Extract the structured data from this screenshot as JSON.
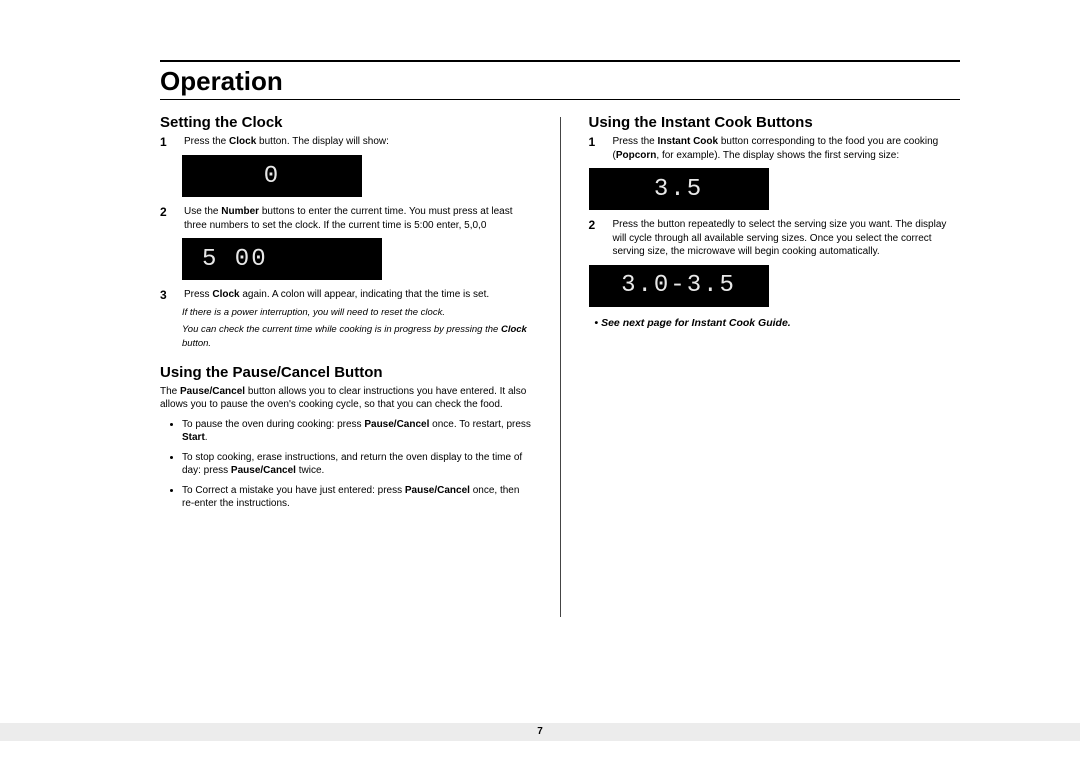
{
  "page_title": "Operation",
  "page_number": "7",
  "left": {
    "section1_title": "Setting the Clock",
    "step1_num": "1",
    "step1_pre": "Press the ",
    "step1_bold": "Clock",
    "step1_post": " button. The display will show:",
    "lcd1": "0",
    "step2_num": "2",
    "step2_pre": "Use the ",
    "step2_bold": "Number",
    "step2_post": " buttons to enter the current time. You must press at least three numbers to set the clock. If the current time is 5:00 enter, 5,0,0",
    "lcd2": "5 00",
    "step3_num": "3",
    "step3_pre": "Press ",
    "step3_bold": "Clock",
    "step3_post": " again. A colon will appear, indicating that the time is set.",
    "note1": "If there is a power interruption, you will need to reset the clock.",
    "note2_pre": "You can check the current time while cooking is in progress by pressing the ",
    "note2_bold": "Clock",
    "note2_post": " button.",
    "section2_title": "Using the Pause/Cancel Button",
    "para_pre": "The ",
    "para_bold": "Pause/Cancel",
    "para_post": " button allows you to clear instructions you have entered.  It also allows you to pause the oven's cooking cycle, so that you can check the food.",
    "b1_pre": "To pause the oven during cooking: press ",
    "b1_bold1": "Pause/Cancel",
    "b1_mid": " once. To restart, press ",
    "b1_bold2": "Start",
    "b1_post": ".",
    "b2_pre": "To stop cooking, erase instructions, and return the oven display to the time of day: press ",
    "b2_bold": "Pause/Cancel",
    "b2_post": " twice.",
    "b3_pre": "To Correct a mistake you have just entered: press ",
    "b3_bold": "Pause/Cancel",
    "b3_post": " once, then re-enter the instructions."
  },
  "right": {
    "section_title": "Using the Instant Cook Buttons",
    "step1_num": "1",
    "step1_pre": "Press the ",
    "step1_bold1": "Instant Cook",
    "step1_mid": " button corresponding to the food you are cooking (",
    "step1_bold2": "Popcorn",
    "step1_post": ", for example). The display shows the first serving size:",
    "lcd1": "3.5",
    "step2_num": "2",
    "step2_text": "Press the button repeatedly to select the serving size you want. The display will cycle through all available serving sizes.  Once you select the correct serving size, the microwave will begin cooking automatically.",
    "lcd2": "3.0-3.5",
    "see_next": "See next page for Instant Cook Guide."
  }
}
